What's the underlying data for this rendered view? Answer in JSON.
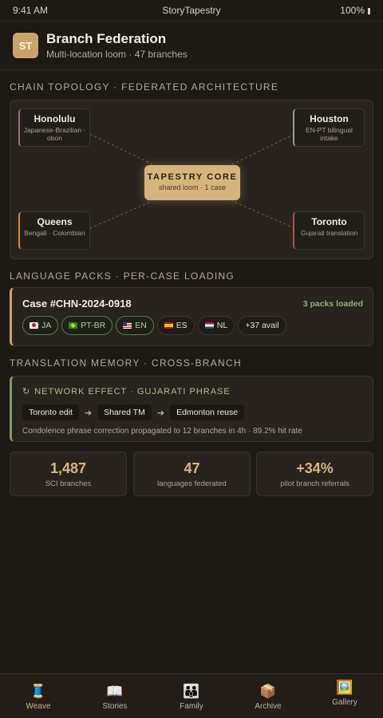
{
  "status_bar": {
    "time": "9:41 AM",
    "app": "StoryTapestry",
    "battery": "100%"
  },
  "header": {
    "avatar": "ST",
    "title": "Branch Federation",
    "subtitle": "Multi-location loom · 47 branches"
  },
  "topology": {
    "section_label": "CHAIN TOPOLOGY · FEDERATED ARCHITECTURE",
    "core": {
      "name": "TAPESTRY CORE",
      "desc": "shared loom · 1 case"
    },
    "nodes": [
      {
        "name": "Honolulu",
        "desc": "Japanese-Brazilian · obon",
        "color": "#9c6a7c"
      },
      {
        "name": "Houston",
        "desc": "EN-PT bilingual intake",
        "color": "#8aa47a"
      },
      {
        "name": "Queens",
        "desc": "Bengali · Colombian",
        "color": "#d9892f"
      },
      {
        "name": "Toronto",
        "desc": "Gujarati translation",
        "color": "#b84f4a"
      }
    ]
  },
  "language_packs": {
    "section_label": "LANGUAGE PACKS · PER-CASE LOADING",
    "case_title": "Case #CHN-2024-0918",
    "loaded": "3 packs loaded",
    "chips": [
      {
        "label": "JA",
        "flag": "flag-ja",
        "active": true
      },
      {
        "label": "PT-BR",
        "flag": "flag-br",
        "active": true
      },
      {
        "label": "EN",
        "flag": "flag-us",
        "active": true
      },
      {
        "label": "ES",
        "flag": "flag-es",
        "active": false
      },
      {
        "label": "NL",
        "flag": "flag-nl",
        "active": false
      },
      {
        "label": "+37 avail",
        "flag": "",
        "active": false
      }
    ]
  },
  "translation_memory": {
    "section_label": "TRANSLATION MEMORY · CROSS-BRANCH",
    "icon": "refresh-icon",
    "title": "NETWORK EFFECT · GUJARATI PHRASE",
    "flow": [
      "Toronto edit",
      "Shared TM",
      "Edmonton reuse"
    ],
    "note": "Condolence phrase correction propagated to 12 branches in 4h · 89.2% hit rate"
  },
  "stats": [
    {
      "value": "1,487",
      "label": "SCI branches"
    },
    {
      "value": "47",
      "label": "languages federated"
    },
    {
      "value": "+34%",
      "label": "pilot branch referrals"
    }
  ],
  "nav": [
    {
      "label": "Weave",
      "icon": "🧵",
      "active": true
    },
    {
      "label": "Stories",
      "icon": "📖",
      "active": false
    },
    {
      "label": "Family",
      "icon": "👪",
      "active": false
    },
    {
      "label": "Archive",
      "icon": "📦",
      "active": false
    },
    {
      "label": "Gallery",
      "icon": "🖼️",
      "active": false
    }
  ],
  "colors": {
    "accent": "#d7b57e",
    "green": "#8fae76",
    "background": "#1d1915"
  }
}
